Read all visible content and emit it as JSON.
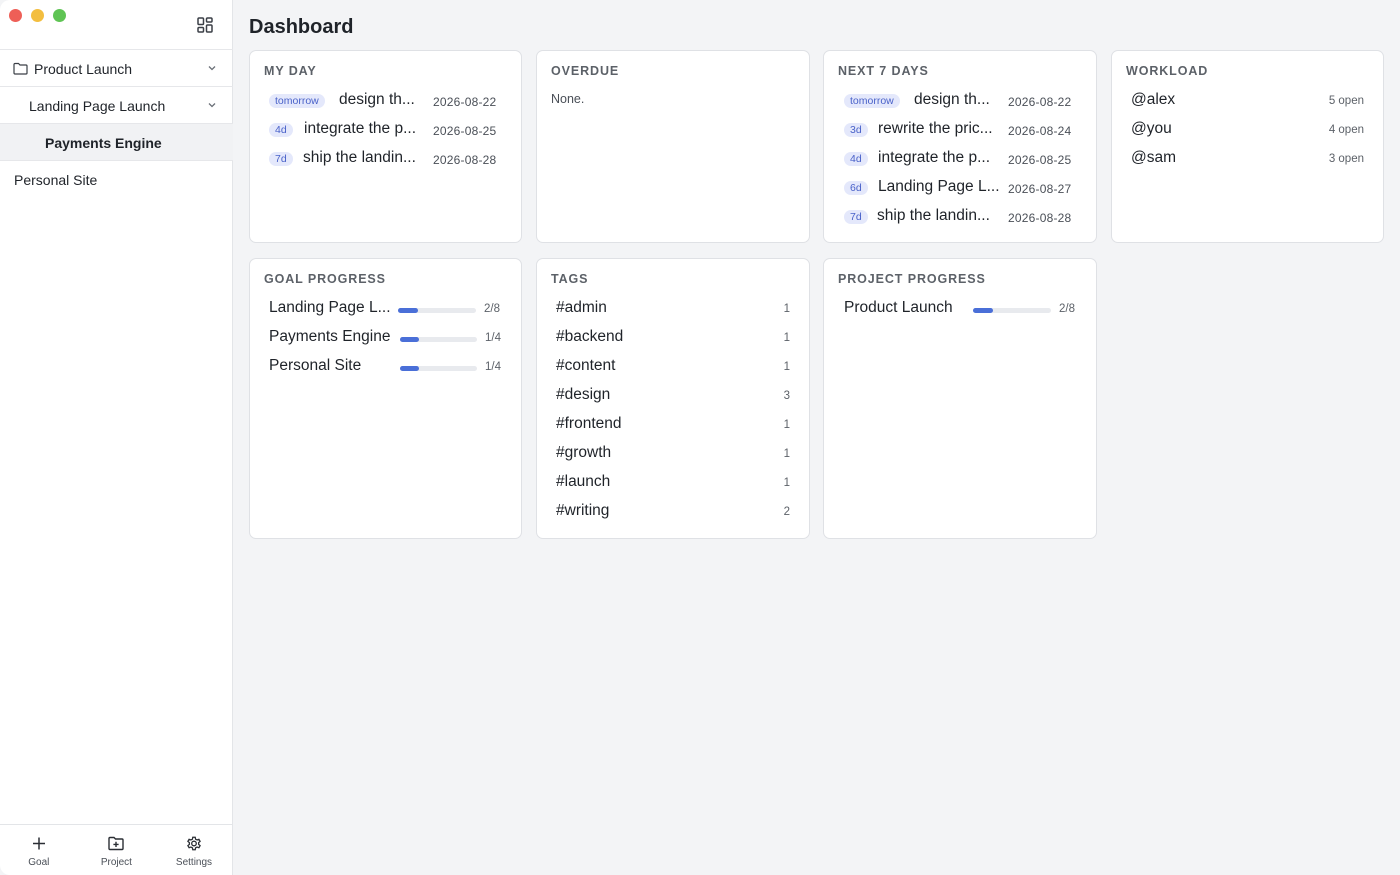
{
  "sidebar": {
    "tree": [
      {
        "label": "Product Launch",
        "level": 0,
        "expanded": true,
        "has_folder_icon": true
      },
      {
        "label": "Landing Page Launch",
        "level": 1,
        "expanded": true
      },
      {
        "label": "Payments Engine",
        "level": 2,
        "selected": true
      },
      {
        "label": "Personal Site",
        "level": 0
      }
    ],
    "footer": [
      {
        "label": "Goal",
        "icon": "plus-icon"
      },
      {
        "label": "Project",
        "icon": "folder-plus-icon"
      },
      {
        "label": "Settings",
        "icon": "gear-icon"
      }
    ]
  },
  "page": {
    "title": "Dashboard"
  },
  "cards": {
    "my_day": {
      "title": "MY DAY",
      "items": [
        {
          "badge": "tomorrow",
          "task": "design th...",
          "date": "2026-08-22"
        },
        {
          "badge": "4d",
          "task": "integrate the p...",
          "date": "2026-08-25"
        },
        {
          "badge": "7d",
          "task": "ship the landin...",
          "date": "2026-08-28"
        }
      ]
    },
    "overdue": {
      "title": "OVERDUE",
      "empty_text": "None."
    },
    "next7": {
      "title": "NEXT 7 DAYS",
      "items": [
        {
          "badge": "tomorrow",
          "task": "design th...",
          "date": "2026-08-22"
        },
        {
          "badge": "3d",
          "task": "rewrite the pric...",
          "date": "2026-08-24"
        },
        {
          "badge": "4d",
          "task": "integrate the p...",
          "date": "2026-08-25"
        },
        {
          "badge": "6d",
          "task": "Landing Page L...",
          "date": "2026-08-27"
        },
        {
          "badge": "7d",
          "task": "ship the landin...",
          "date": "2026-08-28"
        }
      ]
    },
    "workload": {
      "title": "WORKLOAD",
      "items": [
        {
          "name": "@alex",
          "open": "5 open"
        },
        {
          "name": "@you",
          "open": "4 open"
        },
        {
          "name": "@sam",
          "open": "3 open"
        }
      ]
    },
    "goal_progress": {
      "title": "GOAL PROGRESS",
      "items": [
        {
          "name": "Landing Page L...",
          "fraction": "2/8",
          "progress": 0.25
        },
        {
          "name": "Payments Engine",
          "fraction": "1/4",
          "progress": 0.25
        },
        {
          "name": "Personal Site",
          "fraction": "1/4",
          "progress": 0.25
        }
      ]
    },
    "tags": {
      "title": "TAGS",
      "items": [
        {
          "tag": "#admin",
          "count": "1"
        },
        {
          "tag": "#backend",
          "count": "1"
        },
        {
          "tag": "#content",
          "count": "1"
        },
        {
          "tag": "#design",
          "count": "3"
        },
        {
          "tag": "#frontend",
          "count": "1"
        },
        {
          "tag": "#growth",
          "count": "1"
        },
        {
          "tag": "#launch",
          "count": "1"
        },
        {
          "tag": "#writing",
          "count": "2"
        }
      ]
    },
    "project_progress": {
      "title": "PROJECT PROGRESS",
      "items": [
        {
          "name": "Product Launch",
          "fraction": "2/8",
          "progress": 0.25
        }
      ]
    }
  },
  "colors": {
    "accent": "#4a6fd8",
    "pill_bg": "#e4e8fb",
    "pill_text": "#4a62c9"
  }
}
